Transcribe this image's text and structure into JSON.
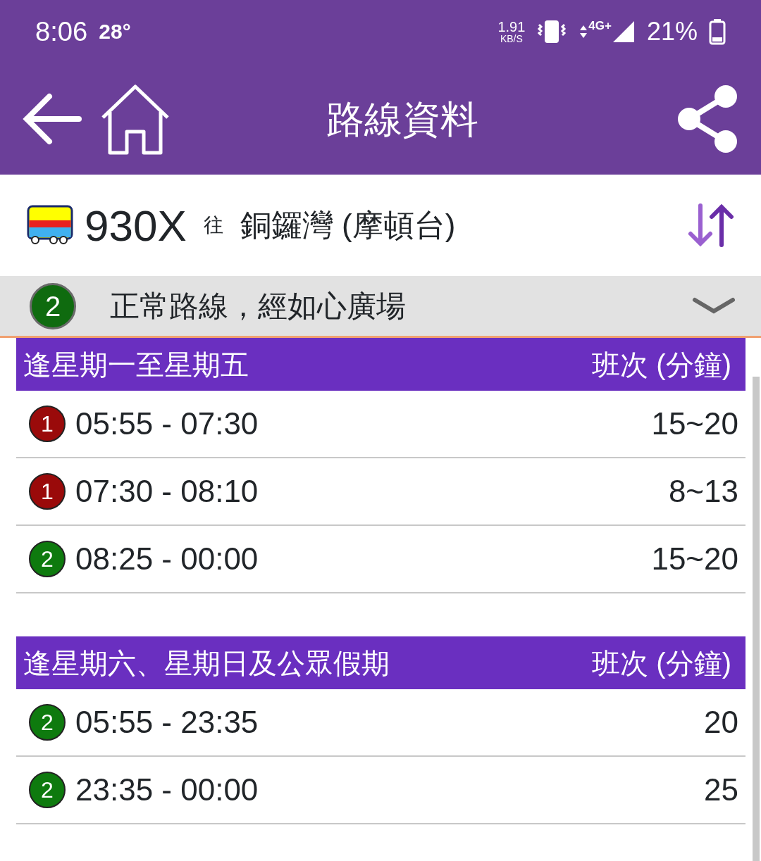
{
  "status_bar": {
    "time": "8:06",
    "temperature": "28°",
    "speed": "1.91",
    "speed_unit": "KB/S",
    "network": "4G+",
    "battery": "21%"
  },
  "app_bar": {
    "title": "路線資料"
  },
  "route": {
    "number": "930X",
    "to_label": "往",
    "destination": "銅鑼灣 (摩頓台)"
  },
  "variant": {
    "badge": "2",
    "color": "#0f6b0f",
    "label": "正常路線，經如心廣場",
    "expanded": false
  },
  "sections": [
    {
      "title": "逢星期一至星期五",
      "frequency_heading": "班次 (分鐘)",
      "rows": [
        {
          "badge": "1",
          "color": "#9a0a0a",
          "period": "05:55 - 07:30",
          "frequency": "15~20"
        },
        {
          "badge": "1",
          "color": "#9a0a0a",
          "period": "07:30 - 08:10",
          "frequency": "8~13"
        },
        {
          "badge": "2",
          "color": "#0e7a0e",
          "period": "08:25 - 00:00",
          "frequency": "15~20"
        }
      ]
    },
    {
      "title": "逢星期六、星期日及公眾假期",
      "frequency_heading": "班次 (分鐘)",
      "rows": [
        {
          "badge": "2",
          "color": "#0e7a0e",
          "period": "05:55 - 23:35",
          "frequency": "20"
        },
        {
          "badge": "2",
          "color": "#0e7a0e",
          "period": "23:35 - 00:00",
          "frequency": "25"
        }
      ]
    }
  ]
}
